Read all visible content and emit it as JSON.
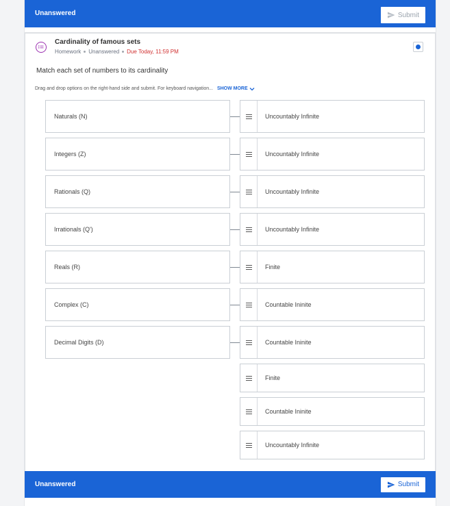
{
  "status_top": "Unanswered",
  "status_bottom": "Unanswered",
  "submit_label": "Submit",
  "question": {
    "title": "Cardinality of famous sets",
    "type": "Homework",
    "status": "Unanswered",
    "due": "Due Today, 11:59 PM",
    "prompt": "Match each set of numbers to its cardinality",
    "instructions": "Drag and drop options on the right-hand side and submit. For keyboard navigation...",
    "show_more": "SHOW MORE"
  },
  "left_items": [
    "Naturals (N)",
    "Integers (Z)",
    "Rationals (Q)",
    "Irrationals (Q')",
    "Reals (R)",
    "Complex (C)",
    "Decimal Digits (D)"
  ],
  "right_items": [
    "Uncountably Infinite",
    "Uncountably Infinite",
    "Uncountably Infinite",
    "Uncountably Infinite",
    "Finite",
    "Countable Ininite",
    "Countable Ininite",
    "Finite",
    "Countable Ininite",
    "Uncountably Infinite"
  ],
  "colors": {
    "accent": "#1a64d6",
    "icon_purple": "#9b2fb0",
    "due_red": "#d03030"
  }
}
